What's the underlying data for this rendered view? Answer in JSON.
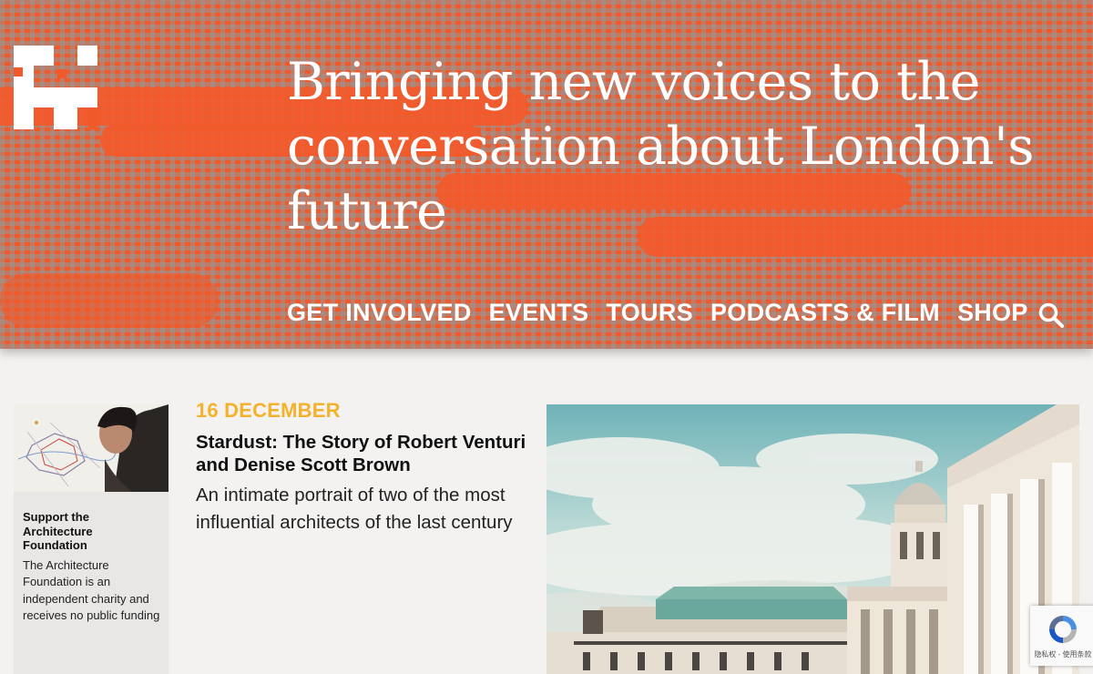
{
  "hero": {
    "headline": "Bringing new voices to the conversation about London's future",
    "logo_icon": "pixel-h-logo-icon"
  },
  "nav": {
    "items": [
      "GET INVOLVED",
      "EVENTS",
      "TOURS",
      "PODCASTS & FILM",
      "SHOP"
    ],
    "search_icon": "search-icon"
  },
  "support": {
    "title": "Support the Architecture Foundation",
    "text": "The Architecture Foundation is an independent charity and receives no public funding"
  },
  "event": {
    "date": "16 DECEMBER",
    "title": "Stardust: The Story of Robert Venturi and Denise Scott Brown",
    "description": "An intimate portrait of two of the most influential architects of the last century"
  },
  "recaptcha": {
    "text": "隐私权 - 使用条款",
    "icon": "recaptcha-icon"
  },
  "colors": {
    "hero_orange": "#f05a2a",
    "date_yellow": "#f3b22b",
    "white": "#ffffff"
  }
}
